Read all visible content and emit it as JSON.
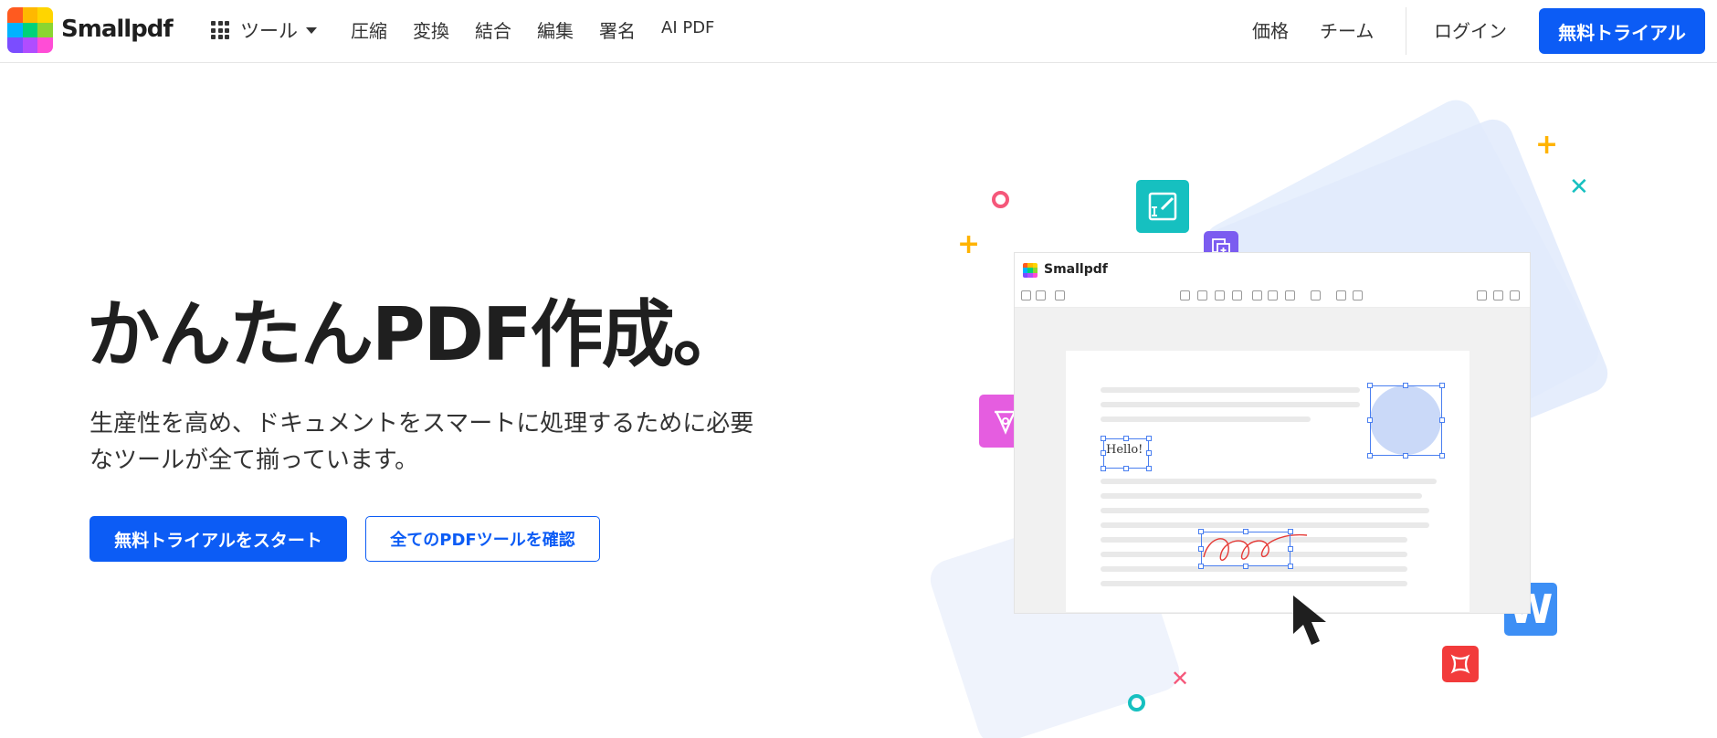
{
  "header": {
    "brand": "Smallpdf",
    "tools_label": "ツール",
    "nav": [
      "圧縮",
      "変換",
      "結合",
      "編集",
      "署名",
      "AI PDF"
    ],
    "right_nav": [
      "価格",
      "チーム"
    ],
    "login": "ログイン",
    "trial_button": "無料トライアル"
  },
  "hero": {
    "title": "かんたんPDF作成。",
    "description_line1": "生産性を高め、ドキュメントをスマートに処理するために必要",
    "description_line2": "なツールが全て揃っています。",
    "primary_cta": "無料トライアルをスタート",
    "secondary_cta": "全てのPDFツールを確認"
  },
  "illustration": {
    "window_brand": "Smallpdf",
    "sample_text": "Hello!",
    "word_letter": "W"
  },
  "colors": {
    "accent": "#0c5cf5",
    "logo_cells": [
      "#ff5a1f",
      "#ffb800",
      "#ffd500",
      "#00b2ff",
      "#00d27a",
      "#8bd531",
      "#7b4dff",
      "#b04dff",
      "#ff4dd6"
    ],
    "teal": "#16c0c0",
    "purple": "#7b5cf0",
    "pink": "#e55de0",
    "yellow": "#ffb300",
    "red": "#f23b3b",
    "word_blue": "#3d8ff5"
  }
}
